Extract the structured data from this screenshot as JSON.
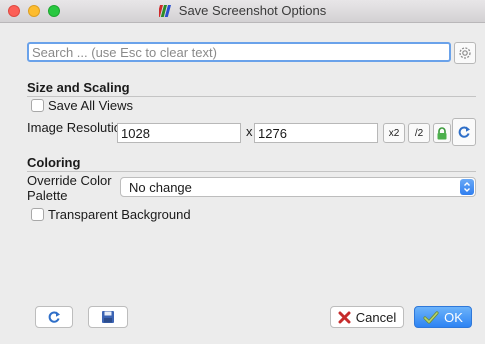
{
  "window": {
    "title": "Save Screenshot Options"
  },
  "search": {
    "placeholder": "Search ... (use Esc to clear text)",
    "value": ""
  },
  "size_scaling": {
    "heading": "Size and Scaling",
    "save_all_views": {
      "label": "Save All Views",
      "checked": false
    },
    "resolution_label": "Image Resolution",
    "width": "1028",
    "separator": "x",
    "height": "1276",
    "x2_label": "x2",
    "div2_label": "/2"
  },
  "coloring": {
    "heading": "Coloring",
    "override_label_line1": "Override Color",
    "override_label_line2": "Palette",
    "palette_value": "No change",
    "transparent_bg": {
      "label": "Transparent Background",
      "checked": false
    }
  },
  "footer": {
    "cancel_label": "Cancel",
    "ok_label": "OK"
  },
  "colors": {
    "accent": "#2f7ef0",
    "close": "#fc5f57",
    "minimize": "#fdbc2e",
    "maximize": "#28c840"
  },
  "icons": [
    "gear-icon",
    "lock-icon",
    "reset-icon",
    "save-icon",
    "cancel-x-icon",
    "ok-check-icon"
  ]
}
